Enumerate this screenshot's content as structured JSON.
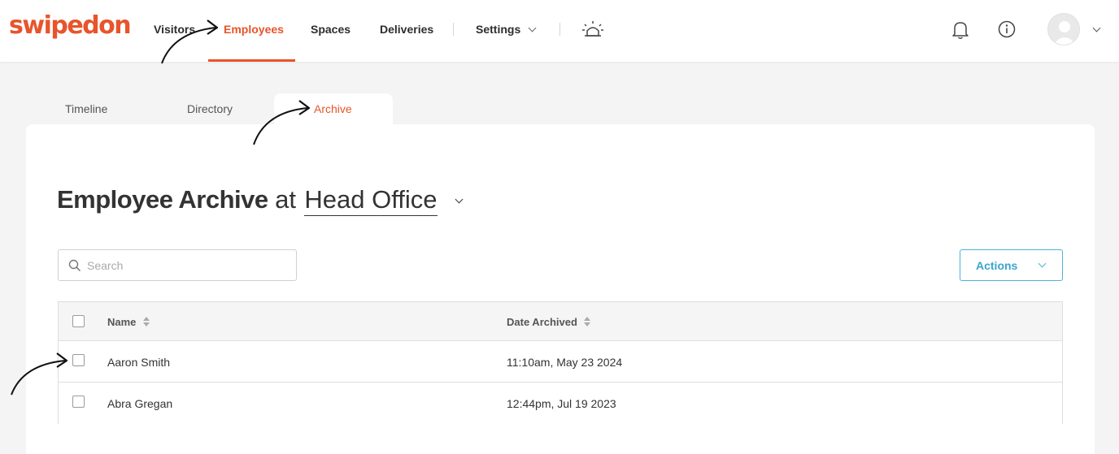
{
  "brand": {
    "logo_text": "swipedon",
    "accent": "#e8542b",
    "link_color": "#3aa6cc"
  },
  "nav": {
    "items": [
      {
        "label": "Visitors",
        "active": false
      },
      {
        "label": "Employees",
        "active": true
      },
      {
        "label": "Spaces",
        "active": false
      },
      {
        "label": "Deliveries",
        "active": false
      },
      {
        "label": "Settings",
        "active": false
      }
    ],
    "icons": [
      "emergency-alarm-icon",
      "bell-icon",
      "info-icon",
      "user-avatar-icon"
    ]
  },
  "tabs": [
    {
      "label": "Timeline",
      "active": false
    },
    {
      "label": "Directory",
      "active": false
    },
    {
      "label": "Archive",
      "active": true
    }
  ],
  "page": {
    "title_strong": "Employee Archive",
    "title_at": "at",
    "location": "Head Office"
  },
  "search": {
    "placeholder": "Search",
    "value": ""
  },
  "actions": {
    "label": "Actions"
  },
  "table": {
    "columns": [
      "Name",
      "Date Archived"
    ],
    "rows": [
      {
        "name": "Aaron Smith",
        "date": "11:10am, May 23 2024",
        "checked": false
      },
      {
        "name": "Abra Gregan",
        "date": "12:44pm, Jul 19 2023",
        "checked": false
      }
    ]
  }
}
